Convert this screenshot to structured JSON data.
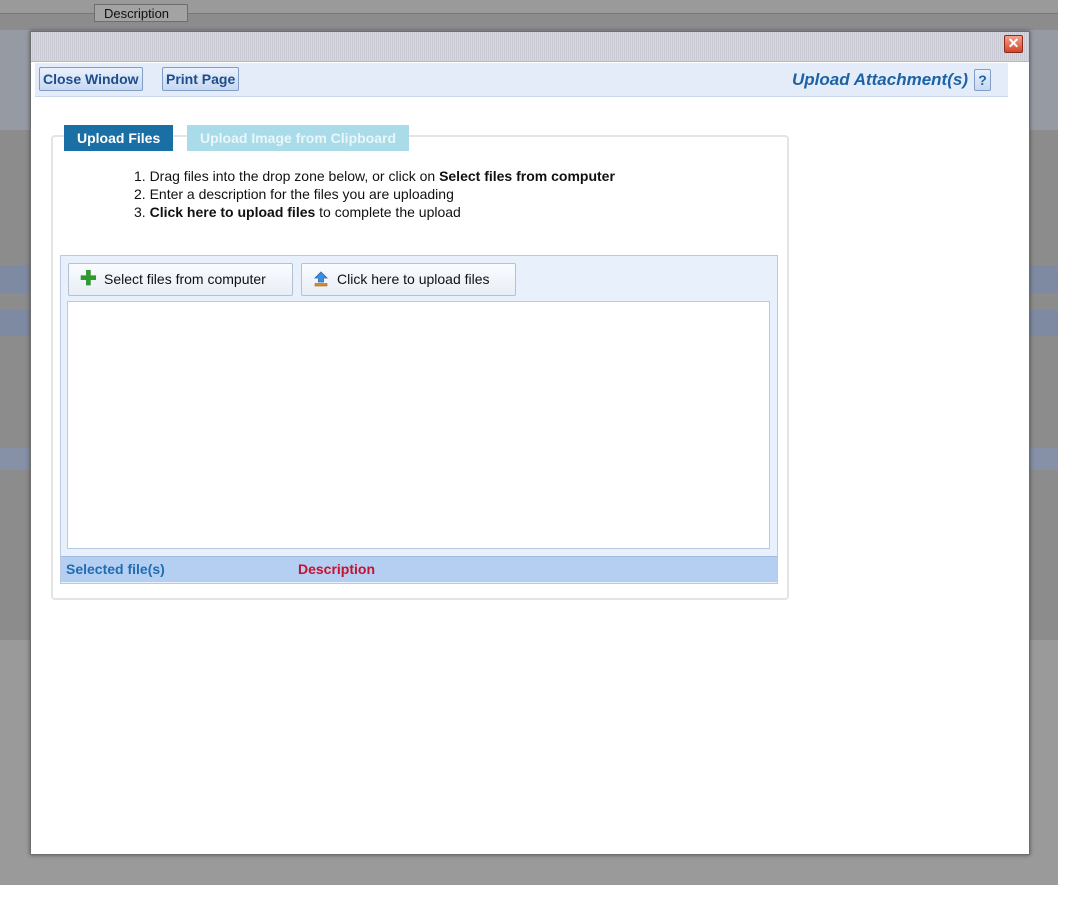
{
  "window": {
    "close_glyph": "✕",
    "toolbar": {
      "close_window": "Close Window",
      "print_page": "Print Page",
      "title": "Upload Attachment(s)",
      "help": "?"
    }
  },
  "tabs": [
    {
      "label": "Upload Files",
      "active": true
    },
    {
      "label": "Upload Image from Clipboard",
      "active": false
    }
  ],
  "instructions": {
    "line1_prefix": "1. Drag files into the drop zone below, or click on ",
    "line1_bold": "Select files from computer",
    "line2": "2. Enter a description for the files you are uploading",
    "line3_prefix": "3. ",
    "line3_bold": "Click here to upload files",
    "line3_suffix": " to complete the upload"
  },
  "uploader": {
    "select_button": "Select files from computer",
    "upload_button": "Click here to upload files",
    "columns": {
      "files": "Selected file(s)",
      "description": "Description"
    }
  },
  "background_page": {
    "description_tab": "Description"
  },
  "colors": {
    "accent": "#1a6fa5",
    "tab_inactive": "#a9dbe9",
    "title": "#1e62a6",
    "description_header": "#c4122f"
  }
}
